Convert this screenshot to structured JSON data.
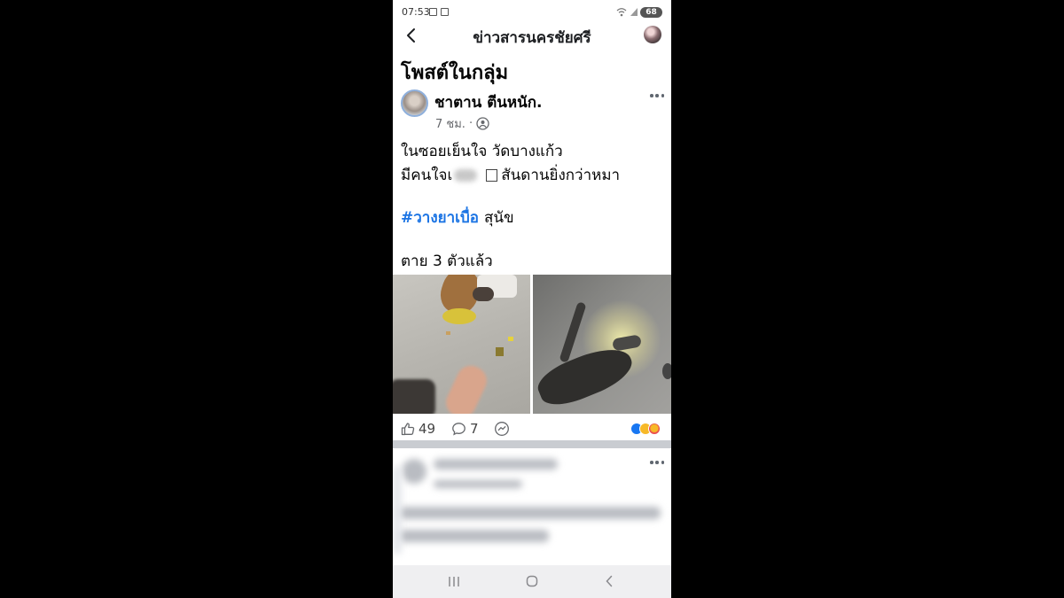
{
  "status_bar": {
    "time": "07:53",
    "battery": "68"
  },
  "header": {
    "title": "ข่าวสารนครชัยศรี"
  },
  "section_title": "โพสต์ในกลุ่ม",
  "post": {
    "author": "ชาตาน ตีนหนัก.",
    "time": "7 ชม.",
    "separator": "·",
    "line1": "ในซอยเย็นใจ วัดบางแก้ว",
    "line2_prefix": "มีคนใจเ",
    "line2_suffix": "สันดานยิ่งกว่าหมา",
    "hashtag": "#วางยาเบื่อ",
    "hashtag_rest": "สุนัข",
    "caption": "ตาย 3 ตัวแล้ว",
    "like_count": "49",
    "comment_count": "7",
    "photo_count": 2
  },
  "icons": {
    "back": "chevron-left-icon",
    "more": "more-options-icon",
    "audience": "group-audience-icon",
    "like": "thumbs-up-icon",
    "comment": "comment-icon",
    "share": "messenger-icon",
    "reactions": [
      "like-reaction-icon",
      "haha-reaction-icon",
      "love-reaction-icon"
    ],
    "nav": [
      "recent-apps-icon",
      "home-icon",
      "nav-back-icon"
    ]
  },
  "colors": {
    "hashtag": "#1b74e4",
    "divider": "#c9ccd1",
    "navbar": "#efeff1",
    "side": "#000000"
  }
}
